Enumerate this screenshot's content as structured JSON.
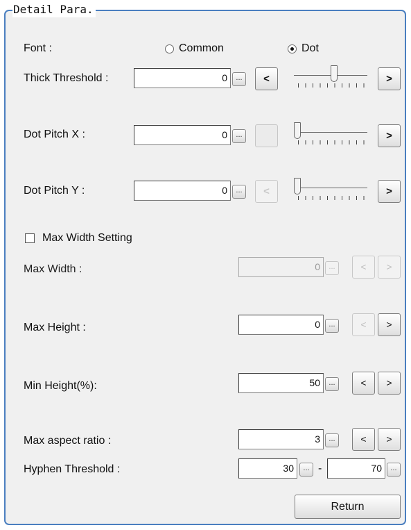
{
  "panel": {
    "title": "Detail Para."
  },
  "font": {
    "label": "Font :",
    "options": [
      {
        "label": "Common",
        "selected": false
      },
      {
        "label": "Dot",
        "selected": true
      }
    ]
  },
  "thick_threshold": {
    "label": "Thick Threshold :",
    "value": "0",
    "more_label": "...",
    "dec_label": "<",
    "inc_label": ">",
    "slider_position": 0.5
  },
  "dot_pitch_x": {
    "label": "Dot Pitch X :",
    "value": "0",
    "more_label": "...",
    "dec_label": "",
    "inc_label": ">",
    "slider_position": 0.0
  },
  "dot_pitch_y": {
    "label": "Dot Pitch Y :",
    "value": "0",
    "more_label": "...",
    "dec_label": "<",
    "inc_label": ">",
    "slider_position": 0.0
  },
  "max_width_setting": {
    "label": "Max Width Setting",
    "checked": false
  },
  "max_width": {
    "label": "Max Width :",
    "value": "0",
    "more_label": "...",
    "dec_label": "<",
    "inc_label": ">"
  },
  "max_height": {
    "label": "Max Height :",
    "value": "0",
    "more_label": "...",
    "dec_label": "<",
    "inc_label": ">"
  },
  "min_height": {
    "label": "Min Height(%):",
    "value": "50",
    "more_label": "...",
    "dec_label": "<",
    "inc_label": ">"
  },
  "max_aspect_ratio": {
    "label": "Max aspect ratio :",
    "value": "3",
    "more_label": "...",
    "dec_label": "<",
    "inc_label": ">"
  },
  "hyphen_threshold": {
    "label": "Hyphen Threshold :",
    "low_value": "30",
    "separator": "-",
    "high_value": "70",
    "more_label": "..."
  },
  "return_button": {
    "label": "Return"
  }
}
